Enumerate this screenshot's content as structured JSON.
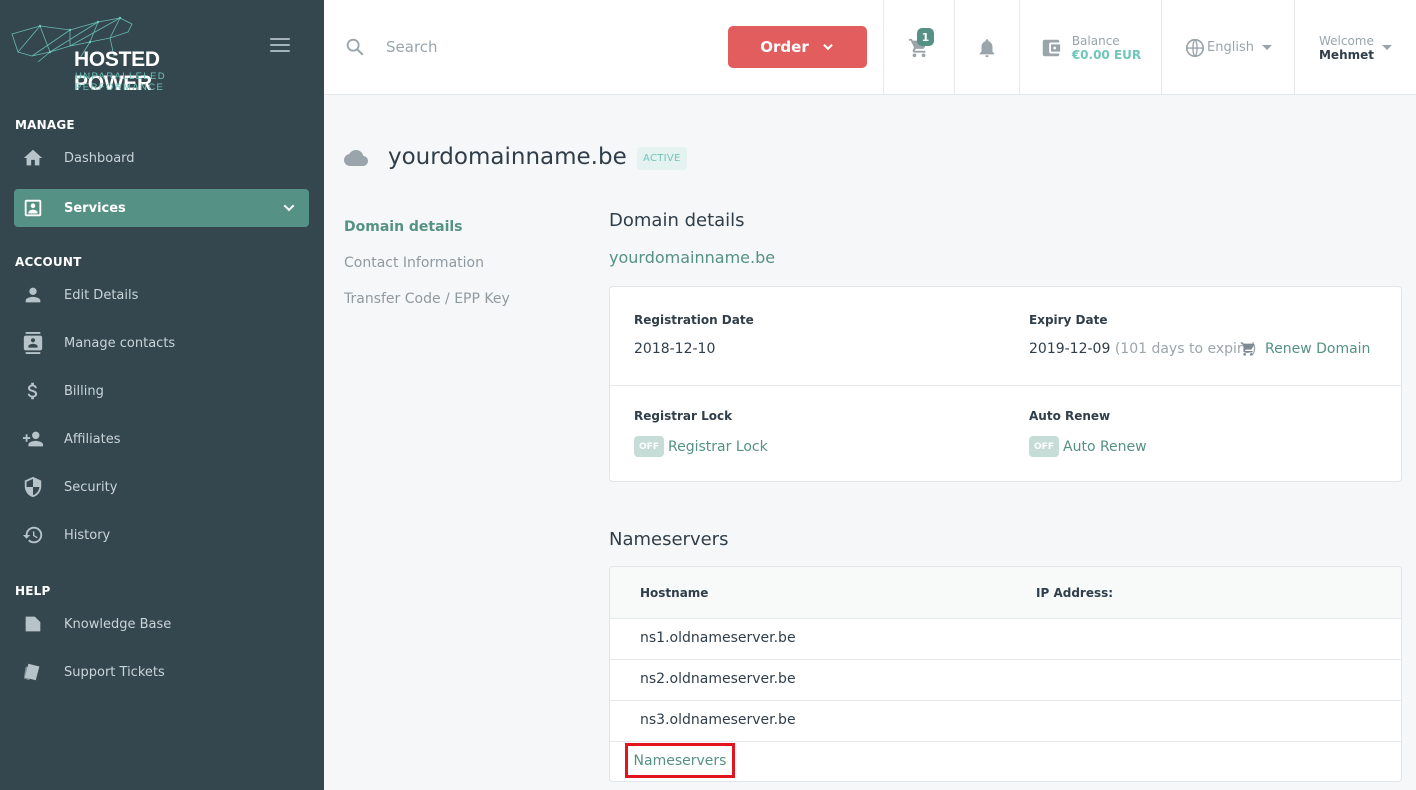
{
  "brand": {
    "name": "HOSTED POWER",
    "tagline": "UNPARALLELED PERFORMANCE"
  },
  "sidebar": {
    "sections": [
      {
        "title": "MANAGE",
        "items": [
          {
            "label": "Dashboard",
            "icon": "home-icon"
          },
          {
            "label": "Services",
            "icon": "services-icon",
            "active": true
          }
        ]
      },
      {
        "title": "ACCOUNT",
        "items": [
          {
            "label": "Edit Details",
            "icon": "user-icon"
          },
          {
            "label": "Manage contacts",
            "icon": "contacts-icon"
          },
          {
            "label": "Billing",
            "icon": "dollar-icon"
          },
          {
            "label": "Affiliates",
            "icon": "affiliates-icon"
          },
          {
            "label": "Security",
            "icon": "shield-icon"
          },
          {
            "label": "History",
            "icon": "history-icon"
          }
        ]
      },
      {
        "title": "HELP",
        "items": [
          {
            "label": "Knowledge Base",
            "icon": "book-icon"
          },
          {
            "label": "Support Tickets",
            "icon": "tickets-icon"
          }
        ]
      }
    ]
  },
  "topbar": {
    "search_placeholder": "Search",
    "order_label": "Order",
    "cart_count": "1",
    "balance_label": "Balance",
    "balance_value": "€0.00 EUR",
    "language": "English",
    "welcome_label": "Welcome",
    "user_name": "Mehmet"
  },
  "page": {
    "title": "yourdomainname.be",
    "status": "ACTIVE",
    "subnav": [
      "Domain details",
      "Contact Information",
      "Transfer Code / EPP Key"
    ],
    "details_heading": "Domain details",
    "domain_link": "yourdomainname.be",
    "registration_label": "Registration Date",
    "registration_value": "2018-12-10",
    "expiry_label": "Expiry Date",
    "expiry_value": "2019-12-09",
    "expiry_note": "(101 days to expire)",
    "renew_label": "Renew Domain",
    "registrar_lock_label": "Registrar Lock",
    "registrar_lock_state": "OFF",
    "registrar_lock_text": "Registrar Lock",
    "auto_renew_label": "Auto Renew",
    "auto_renew_state": "OFF",
    "auto_renew_text": "Auto Renew",
    "nameservers_heading": "Nameservers",
    "ns_headers": [
      "Hostname",
      "IP Address:"
    ],
    "nameservers": [
      "ns1.oldnameserver.be",
      "ns2.oldnameserver.be",
      "ns3.oldnameserver.be"
    ],
    "ns_link": "Nameservers"
  },
  "colors": {
    "sidebar": "#34474f",
    "accent": "#559184",
    "order": "#e25d5d",
    "highlight": "#e2141d"
  }
}
